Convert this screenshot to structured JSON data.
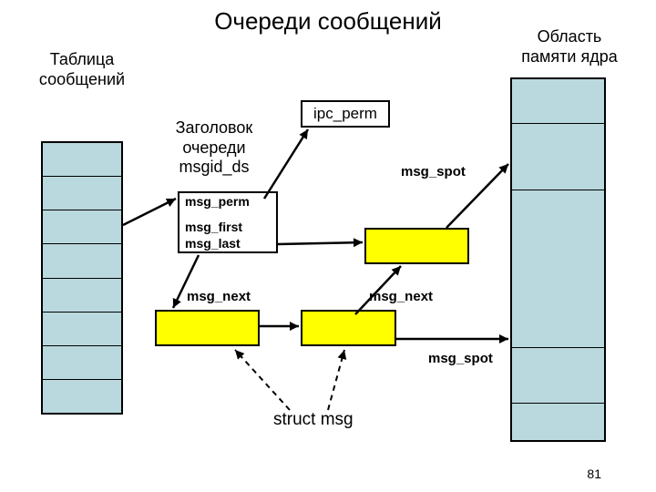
{
  "title": "Очереди сообщений",
  "labels": {
    "msg_table": "Таблица\nсообщений",
    "kernel_area": "Область\nпамяти ядра",
    "header": "Заголовок\nочереди\nmsgid_ds",
    "ipc_perm": "ipc_perm",
    "struct_msg": "struct msg"
  },
  "fields": {
    "msg_perm": "msg_perm",
    "msg_first": "msg_first",
    "msg_last": "msg_last",
    "msg_next1": "msg_next",
    "msg_next2": "msg_next",
    "msg_spot1": "msg_spot",
    "msg_spot2": "msg_spot"
  },
  "pagenum": "81"
}
